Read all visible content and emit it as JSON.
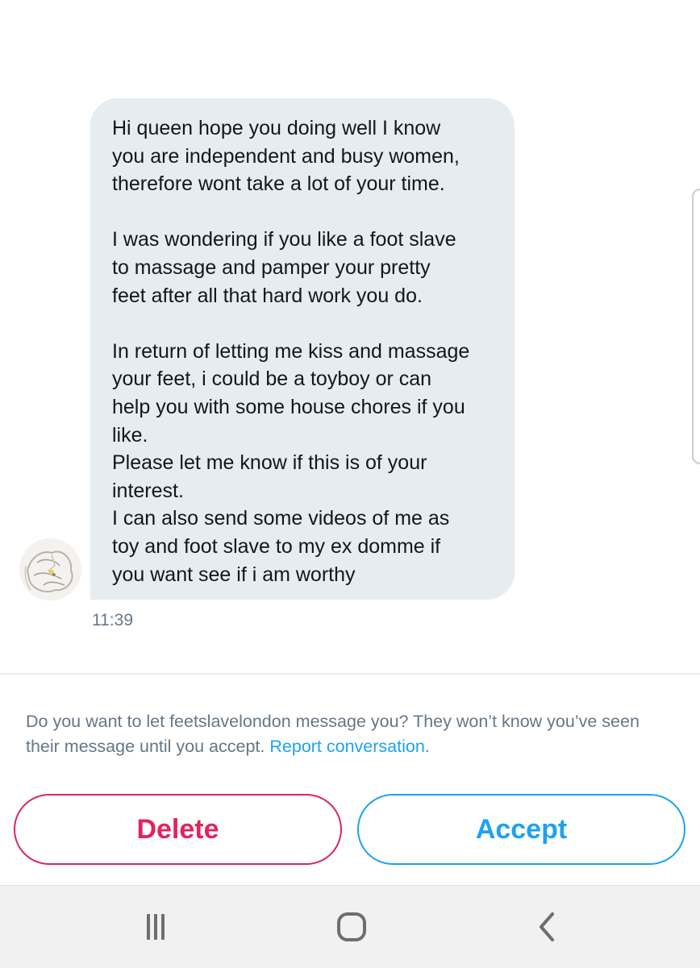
{
  "message": {
    "lines": [
      "Hi queen hope you doing well I know",
      "you are independent and busy women,",
      "therefore wont take a lot of your time.",
      "",
      "I was wondering if you like a foot slave",
      "to massage and pamper your pretty",
      "feet after all that hard work you do.",
      "",
      "In return of letting me kiss and massage",
      "your feet, i could be a toyboy or can",
      "help you with some house chores if you",
      "like.",
      "Please let me know if this is of your",
      "interest.",
      "I can also send some videos of me as",
      "toy and foot slave to my ex domme if",
      "you want see if i am worthy"
    ],
    "timestamp": "11:39"
  },
  "request": {
    "prompt_text": "Do you want to let feetslavelondon message you? They won’t know you’ve seen their message until you accept.",
    "report_link": "Report conversation",
    "trailing_period": "."
  },
  "actions": {
    "delete_label": "Delete",
    "accept_label": "Accept"
  },
  "navbar": {
    "recents_icon": "recent-apps-icon",
    "home_icon": "home-icon",
    "back_icon": "back-icon"
  },
  "colors": {
    "bubble": "#e6ecf0",
    "delete": "#e0245e",
    "accept": "#1da1f2",
    "muted_text": "#657786"
  }
}
